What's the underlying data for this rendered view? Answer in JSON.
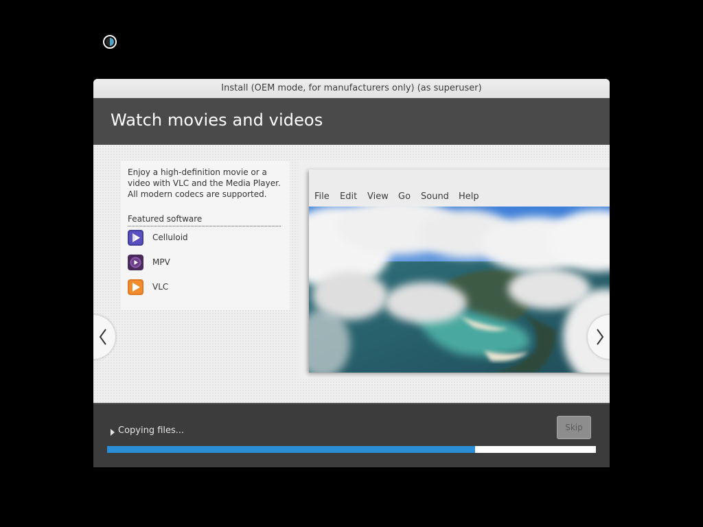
{
  "window": {
    "title": "Install (OEM mode, for manufacturers only) (as superuser)"
  },
  "slide": {
    "title": "Watch movies and videos",
    "description": "Enjoy a high-definition movie or a video with VLC and the Media Player. All modern codecs are supported.",
    "featured_label": "Featured software",
    "software": [
      {
        "name": "Celluloid",
        "icon": "celluloid-icon"
      },
      {
        "name": "MPV",
        "icon": "mpv-icon"
      },
      {
        "name": "VLC",
        "icon": "vlc-icon"
      }
    ]
  },
  "app_preview": {
    "menu": [
      "File",
      "Edit",
      "View",
      "Go",
      "Sound",
      "Help"
    ]
  },
  "navigation": {
    "prev_icon": "chevron-left-icon",
    "next_icon": "chevron-right-icon"
  },
  "status": {
    "text": "Copying files...",
    "skip_label": "Skip",
    "progress_fraction": 0.753
  },
  "colors": {
    "header_bg": "#4a4a4a",
    "footer_bg": "#3c3c3c",
    "progress": "#2a8fd6"
  }
}
